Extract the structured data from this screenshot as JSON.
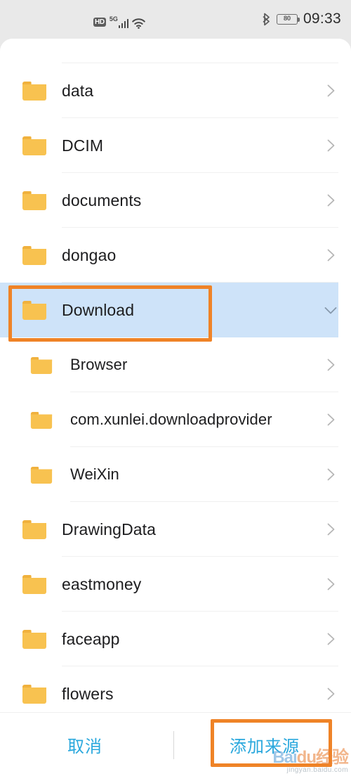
{
  "status_bar": {
    "hd_badge": "HD",
    "network_label": "5G",
    "signal_icon": "signal-bars-icon",
    "wifi_icon": "wifi-icon",
    "bluetooth_icon": "bluetooth-icon",
    "battery_level": "80",
    "time": "09:33"
  },
  "file_picker": {
    "rows": [
      {
        "label": "",
        "level": "top",
        "icon": "folder-icon",
        "chevron": "chevron-right-icon",
        "partial": true,
        "divider": true,
        "selected": false
      },
      {
        "label": "data",
        "level": "top",
        "icon": "folder-icon",
        "chevron": "chevron-right-icon",
        "partial": false,
        "divider": true,
        "selected": false
      },
      {
        "label": "DCIM",
        "level": "top",
        "icon": "folder-icon",
        "chevron": "chevron-right-icon",
        "partial": false,
        "divider": true,
        "selected": false
      },
      {
        "label": "documents",
        "level": "top",
        "icon": "folder-icon",
        "chevron": "chevron-right-icon",
        "partial": false,
        "divider": true,
        "selected": false
      },
      {
        "label": "dongao",
        "level": "top",
        "icon": "folder-icon",
        "chevron": "chevron-right-icon",
        "partial": false,
        "divider": true,
        "selected": false
      },
      {
        "label": "Download",
        "level": "top",
        "icon": "folder-icon",
        "chevron": "chevron-down-icon",
        "partial": false,
        "divider": false,
        "selected": true
      },
      {
        "label": "Browser",
        "level": "child",
        "icon": "folder-icon",
        "chevron": "chevron-right-icon",
        "partial": false,
        "divider": true,
        "selected": false
      },
      {
        "label": "com.xunlei.downloadprovider",
        "level": "child",
        "icon": "folder-icon",
        "chevron": "chevron-right-icon",
        "partial": false,
        "divider": true,
        "selected": false
      },
      {
        "label": "WeiXin",
        "level": "child",
        "icon": "folder-icon",
        "chevron": "chevron-right-icon",
        "partial": false,
        "divider": true,
        "selected": false
      },
      {
        "label": "DrawingData",
        "level": "top",
        "icon": "folder-icon",
        "chevron": "chevron-right-icon",
        "partial": false,
        "divider": true,
        "selected": false
      },
      {
        "label": "eastmoney",
        "level": "top",
        "icon": "folder-icon",
        "chevron": "chevron-right-icon",
        "partial": false,
        "divider": true,
        "selected": false
      },
      {
        "label": "faceapp",
        "level": "top",
        "icon": "folder-icon",
        "chevron": "chevron-right-icon",
        "partial": false,
        "divider": true,
        "selected": false
      },
      {
        "label": "flowers",
        "level": "top",
        "icon": "folder-icon",
        "chevron": "chevron-right-icon",
        "partial": false,
        "divider": true,
        "selected": false
      }
    ],
    "bottom_bar": {
      "cancel_label": "取消",
      "add_source_label": "添加来源"
    }
  },
  "annotations": [
    {
      "name": "download-row-highlight",
      "color": "#ef8327"
    },
    {
      "name": "add-source-button-highlight",
      "color": "#ef8327"
    }
  ],
  "watermark": {
    "brand_first": "Bai",
    "brand_second": "du",
    "brand_suffix": "经验",
    "url": "jingyan.baidu.com"
  },
  "colors": {
    "folder": "#f8c250",
    "folder_dark": "#f0b13d",
    "selected_row": "#cee3f9",
    "accent_link": "#2aa8dd",
    "annotation": "#ef8327",
    "sheet_bg": "#ffffff",
    "screen_bg": "#e9e9e9",
    "divider": "#f0f0f0"
  }
}
